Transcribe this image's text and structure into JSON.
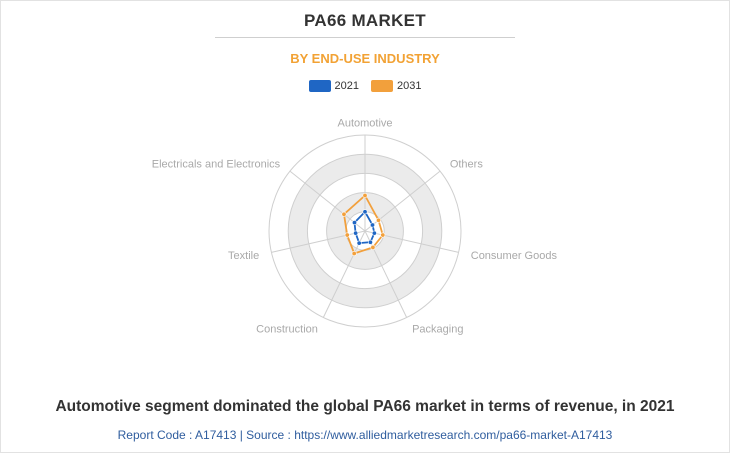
{
  "header": {
    "title": "PA66 MARKET",
    "subtitle": "BY END-USE INDUSTRY"
  },
  "colors": {
    "subtitle": "#f2a234",
    "series_2021": "#1f66c4",
    "series_2031": "#f2a03c",
    "ring_band": "#ebebeb",
    "axis_label": "#a9a9a9"
  },
  "chart_data": {
    "type": "radar",
    "categories": [
      "Automotive",
      "Others",
      "Consumer Goods",
      "Packaging",
      "Construction",
      "Textile",
      "Electricals and Electronics"
    ],
    "series": [
      {
        "name": "2021",
        "values": [
          20,
          10,
          10,
          13,
          14,
          10,
          14
        ]
      },
      {
        "name": "2031",
        "values": [
          37,
          18,
          19,
          19,
          26,
          19,
          28
        ]
      }
    ],
    "scale": [
      0,
      100
    ],
    "rings": 5,
    "legend_position": "top"
  },
  "footer": {
    "caption": "Automotive segment dominated the global PA66 market in terms of revenue, in 2021",
    "report_code": "Report Code : A17413  |  Source : https://www.alliedmarketresearch.com/pa66-market-A17413"
  }
}
